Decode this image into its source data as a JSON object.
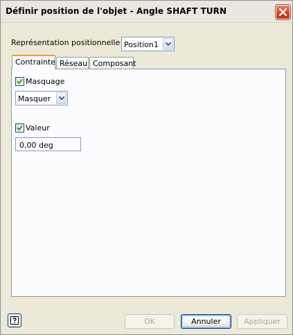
{
  "window": {
    "title": "Définir position de l'objet - Angle SHAFT TURN",
    "close_icon": "close-icon"
  },
  "representation": {
    "label": "Représentation positionnelle",
    "value": "Position1"
  },
  "tabs": [
    {
      "label": "Contrainte",
      "active": true
    },
    {
      "label": "Réseau",
      "active": false
    },
    {
      "label": "Composant",
      "active": false
    }
  ],
  "contrainte": {
    "masquage": {
      "label": "Masquage",
      "checked": true
    },
    "masquage_select": {
      "value": "Masquer"
    },
    "valeur": {
      "label": "Valeur",
      "checked": true
    },
    "valeur_input": {
      "value": "0,00 deg"
    }
  },
  "footer": {
    "help_icon": "help-icon",
    "ok_label": "OK",
    "cancel_label": "Annuler",
    "apply_label": "Appliquer"
  },
  "colors": {
    "active_tab_accent": "#f0a02a",
    "close_button": "#c94a2b",
    "input_border": "#7f9db9"
  }
}
